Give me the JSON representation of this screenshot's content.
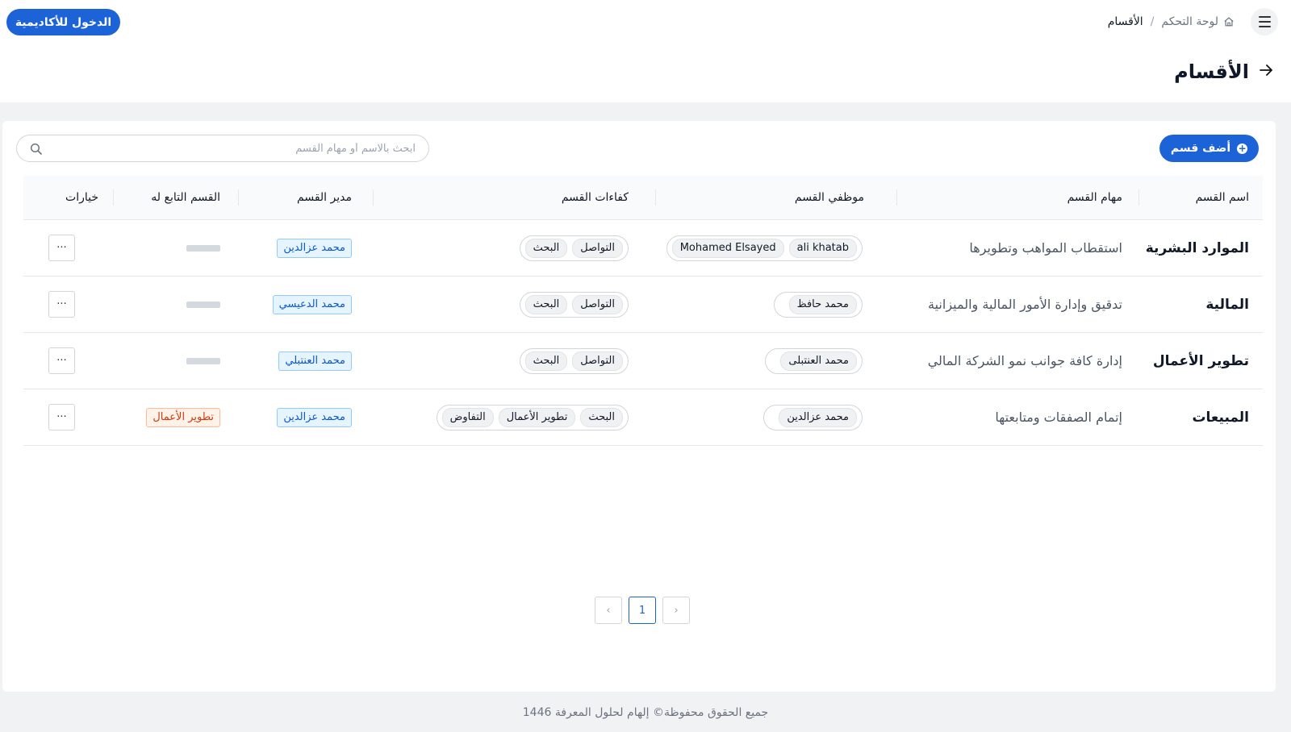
{
  "header": {
    "academy_button": "الدخول للأكاديمية",
    "breadcrumb": {
      "home_icon": "home-icon",
      "home": "لوحة التحكم",
      "separator": "/",
      "current": "الأقسام"
    },
    "menu_icon": "hamburger-menu-icon",
    "back_icon": "arrow-right-icon",
    "page_title": "الأقسام"
  },
  "toolbar": {
    "add_button": "أضف قسم",
    "add_icon": "plus-circle-icon",
    "search_placeholder": "ابحث بالاسم أو مهام القسم",
    "search_value": "",
    "search_icon": "search-icon"
  },
  "table": {
    "columns": {
      "name": "اسم القسم",
      "tasks": "مهام القسم",
      "employees": "موظفي القسم",
      "skills": "كفاءات القسم",
      "manager": "مدير القسم",
      "parent": "القسم التابع له",
      "options": "خيارات"
    },
    "rows": [
      {
        "name": "الموارد البشرية",
        "tasks": "استقطاب المواهب وتطويرها",
        "employees": [
          "ali khatab",
          "Mohamed Elsayed"
        ],
        "skills": [
          "التواصل",
          "البحث"
        ],
        "manager": "محمد عزالدين",
        "parent": "",
        "options": "···"
      },
      {
        "name": "المالية",
        "tasks": "تدقيق وإدارة الأمور المالية والميزانية",
        "employees": [
          "محمد حافظ"
        ],
        "skills": [
          "التواصل",
          "البحث"
        ],
        "manager": "محمد الدعيسي",
        "parent": "",
        "options": "···"
      },
      {
        "name": "تطوير الأعمال",
        "tasks": "إدارة كافة جوانب نمو الشركة المالي",
        "employees": [
          "محمد العنتبلى"
        ],
        "skills": [
          "التواصل",
          "البحث"
        ],
        "manager": "محمد العنتبلي",
        "parent": "",
        "options": "···"
      },
      {
        "name": "المبيعات",
        "tasks": "إتمام الصفقات ومتابعتها",
        "employees": [
          "محمد عزالدين"
        ],
        "skills": [
          "البحث",
          "تطوير الأعمال",
          "التفاوض"
        ],
        "manager": "محمد عزالدين",
        "parent": "تطوير الأعمال",
        "options": "···"
      }
    ]
  },
  "pagination": {
    "prev": "‹",
    "current": "1",
    "next": "›"
  },
  "footer": {
    "text": "جميع الحقوق محفوظة© إلهام لحلول المعرفة 1446"
  },
  "colors": {
    "primary": "#1d63d8",
    "page_bg": "#f1f2f4",
    "manager_tag": "#e6f4ff",
    "parent_tag": "#fff2e8"
  }
}
